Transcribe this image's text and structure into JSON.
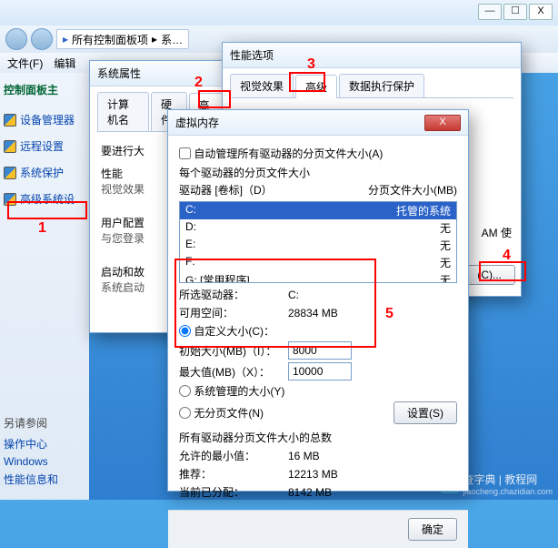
{
  "window": {
    "min": "—",
    "max": "☐",
    "close": "X",
    "crumb_allitems": "所有控制面板项",
    "crumb_system": "系…",
    "menu_file": "文件(F)",
    "menu_edit": "编辑"
  },
  "sidebar": {
    "header": "控制面板主",
    "items": [
      "设备管理器",
      "远程设置",
      "系统保护",
      "高级系统设"
    ],
    "seealso_title": "另请参阅",
    "seealso_items": [
      "操作中心",
      "Windows",
      "性能信息和"
    ]
  },
  "markers": {
    "m1": "1",
    "m2": "2",
    "m3": "3",
    "m4": "4",
    "m5": "5"
  },
  "sysprops": {
    "title": "系统属性",
    "tabs": [
      "计算机名",
      "硬件",
      "高级"
    ],
    "must_line": "要进行大",
    "perf_group": "性能",
    "perf_desc": "视觉效果",
    "user_group": "用户配置",
    "user_desc": "与您登录",
    "startup_group": "启动和故",
    "startup_desc": "系统启动"
  },
  "perfopts": {
    "title": "性能选项",
    "tabs": [
      "视觉效果",
      "高级",
      "数据执行保护"
    ],
    "ram_text": "AM 使",
    "change_btn": "(C)..."
  },
  "vmem": {
    "title": "虚拟内存",
    "auto_chk": "自动管理所有驱动器的分页文件大小(A)",
    "each_drive": "每个驱动器的分页文件大小",
    "col_drive": "驱动器  [卷标]（D）",
    "col_size": "分页文件大小(MB)",
    "drives": [
      {
        "d": "C:",
        "label": "托管的系统",
        "sel": true
      },
      {
        "d": "D:",
        "label": "无"
      },
      {
        "d": "E:",
        "label": "无"
      },
      {
        "d": "F:",
        "label": "无"
      },
      {
        "d": "G:    [常用程序]",
        "label": "无"
      }
    ],
    "selected_drive_lab": "所选驱动器：",
    "selected_drive_val": "C:",
    "avail_lab": "可用空间：",
    "avail_val": "28834 MB",
    "custom_radio": "自定义大小(C)：",
    "init_lab": "初始大小(MB)（I）：",
    "init_val": "8000",
    "max_lab": "最大值(MB)（X）：",
    "max_val": "10000",
    "sysmanaged_radio": "系统管理的大小(Y)",
    "nopage_radio": "无分页文件(N)",
    "set_btn": "设置(S)",
    "totals_title": "所有驱动器分页文件大小的总数",
    "min_lab": "允许的最小值：",
    "min_val": "16 MB",
    "rec_lab": "推荐：",
    "rec_val": "12213 MB",
    "cur_lab": "当前已分配：",
    "cur_val": "8142 MB",
    "ok": "确定"
  },
  "watermark": {
    "site": "查字典",
    "sub": "jiaocheng.chazidian.com",
    "extra": "教程网"
  }
}
